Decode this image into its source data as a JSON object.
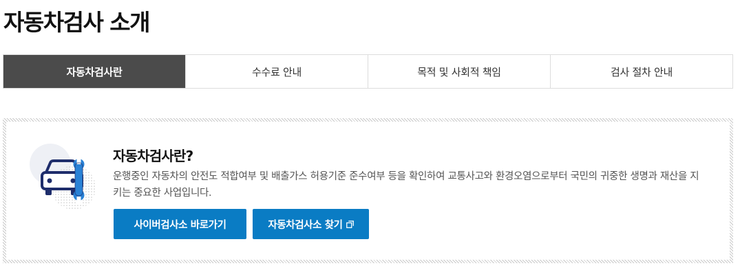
{
  "page": {
    "title": "자동차검사 소개"
  },
  "tabs": [
    {
      "label": "자동차검사란",
      "active": true
    },
    {
      "label": "수수료 안내",
      "active": false
    },
    {
      "label": "목적 및 사회적 책임",
      "active": false
    },
    {
      "label": "검사 절차 안내",
      "active": false
    }
  ],
  "info": {
    "heading": "자동차검사란?",
    "description": "운행중인 자동차의 안전도 적합여부 및 배출가스 허용기준 준수여부 등을 확인하여 교통사고와 환경오염으로부터 국민의 귀중한 생명과 재산을 지키는 중요한 사업입니다.",
    "buttons": [
      {
        "label": "사이버검사소 바로가기"
      },
      {
        "label": "자동차검사소 찾기",
        "icon": "external-link-icon"
      }
    ],
    "illustration_icon": "car-wrench-icon"
  },
  "colors": {
    "active_tab_bg": "#4b4b4b",
    "button_bg": "#0a7cc4",
    "icon_navy": "#1e2d6b",
    "icon_blue": "#2a82d6"
  }
}
